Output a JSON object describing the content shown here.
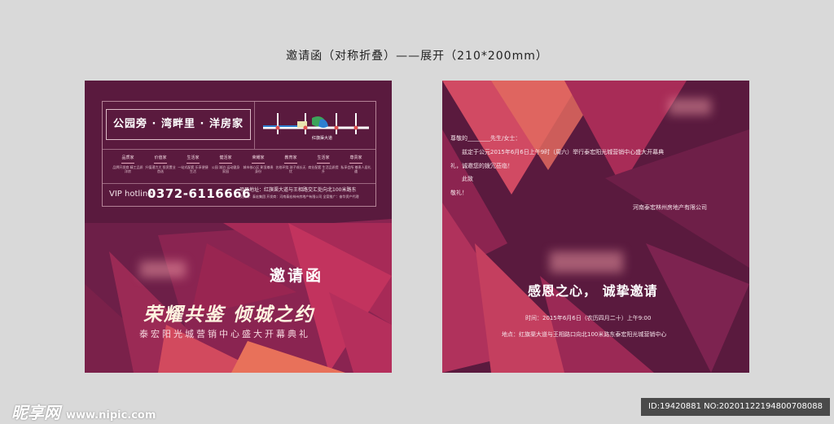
{
  "page_title": "邀请函（对称折叠）——展开（210*200mm）",
  "left": {
    "slogan": "公园旁 · 湾畔里 · 洋房家",
    "map_label": "红旗渠大道",
    "features": [
      {
        "title": "品质家",
        "desc": "品牌开发商 精工品质洋房"
      },
      {
        "title": "价值家",
        "desc": "升值潜力大 投资置业首选"
      },
      {
        "title": "生活家",
        "desc": "一站式配套 乐享便捷生活"
      },
      {
        "title": "健活家",
        "desc": "公园 湖泊 运动健身家园"
      },
      {
        "title": "荣耀家",
        "desc": "城市核心区 彰显尊贵身份"
      },
      {
        "title": "教育家",
        "desc": "名校环绕 孩子成长无忧"
      },
      {
        "title": "生活家",
        "desc": "商业配套 生活品质提升"
      },
      {
        "title": "尊贵家",
        "desc": "私享会所 尊贵人居礼遇"
      }
    ],
    "vip_label": "VIP hotline",
    "phone": "0372-6116666",
    "address": "项目地址：红旗渠大道与王相路交汇处向北100米路东",
    "address_detail": "投资商：泰宏集团  开发商：河南泰宏林州房地产有限公司  全案推广：奋华资产代理",
    "invitation": "邀请函",
    "main_title": "荣耀共鉴 倾城之约",
    "subtitle": "泰宏阳光城营销中心盛大开幕典礼"
  },
  "right": {
    "salutation": "尊敬的________先生/女士：",
    "line1": "兹定于公元2015年6月6日上午9时（周六）举行泰宏阳光城营销中心盛大开幕典",
    "line2": "礼，诚邀您的拨冗莅临！",
    "line3": "此致",
    "line4": "敬礼！",
    "company": "河南泰宏林州房地产有限公司",
    "heading": "感恩之心， 诚挚邀请",
    "time": "时间：2015年6月6日（农历四月二十）上午9:00",
    "place": "地点：红旗渠大道与王相路口向北100米路东泰宏阳光城营销中心"
  },
  "watermark": {
    "brand": "昵享网",
    "url": "www.nipic.com"
  },
  "image_id": "ID:19420881 NO:20201122194800708088",
  "colors": {
    "background": "#d9d9d9",
    "panel": "#5a1a3e",
    "accent": "#c2335e",
    "highlight": "#e8715a"
  }
}
